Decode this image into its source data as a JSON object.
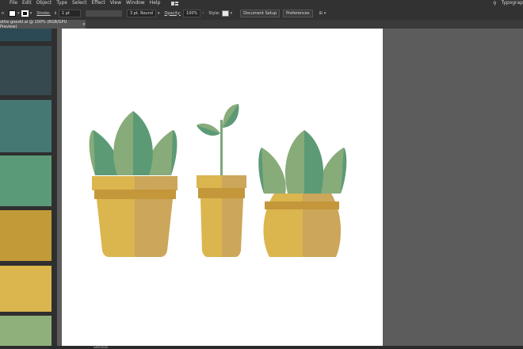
{
  "menu": {
    "items": [
      "File",
      "Edit",
      "Object",
      "Type",
      "Select",
      "Effect",
      "View",
      "Window",
      "Help"
    ],
    "workspace": "Typograp"
  },
  "toolbar": {
    "prefix": "n",
    "stroke_label": "Stroke:",
    "stroke_weight": "1 pt",
    "brush": "3 pt. Round",
    "opacity_label": "Opacity:",
    "opacity_value": "100%",
    "style_label": "Style:",
    "doc_setup": "Document Setup",
    "preferences": "Preferences"
  },
  "tab": {
    "title": "ottie goeskl.ai @ 100% (RGB/GPU Preview)",
    "close": "×"
  },
  "status": {
    "tool": "Selection"
  },
  "colors": {
    "swatches": [
      "#2b4a55",
      "#35494f",
      "#457873",
      "#5a9a78",
      "#c39a38",
      "#dbb54e",
      "#8fb07a"
    ],
    "pot_light": "#dbb54e",
    "pot_dark": "#cca65a",
    "pot_band": "#c3973a",
    "leaf_dark": "#5c9a76",
    "leaf_light": "#88ab7a",
    "stem": "#7aa97a"
  }
}
